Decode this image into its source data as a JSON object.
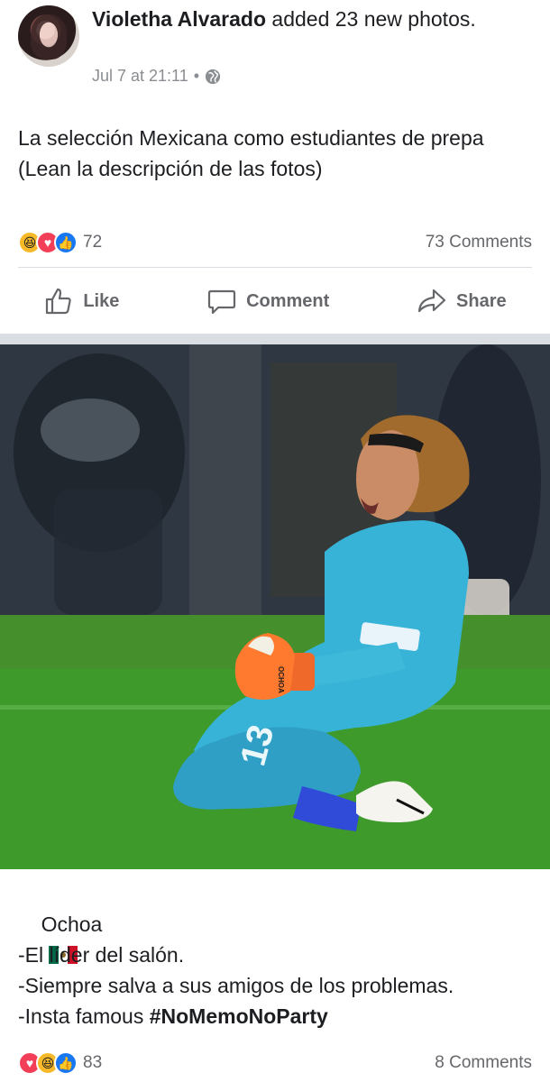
{
  "post": {
    "author": "Violetha Alvarado",
    "action_text": " added 23 new photos.",
    "date": "Jul 7 at 21:11",
    "dot": "•",
    "audience_icon": "globe-icon",
    "text_line1": "La selección Mexicana como estudiantes de prepa",
    "text_line2": "(Lean la descripción de las fotos)",
    "reactions": {
      "icons": [
        "haha",
        "love",
        "like"
      ],
      "count": "72",
      "comments": "73 Comments"
    },
    "actions": {
      "like": "Like",
      "comment": "Comment",
      "share": "Share"
    }
  },
  "photo": {
    "caption_name": "Ochoa",
    "caption_flag": "mexico-flag",
    "caption_lines": [
      "-El líder del salón.",
      "-Siempre salva a sus amigos de los problemas."
    ],
    "caption_line3_prefix": "-Insta famous ",
    "caption_hashtag": "#NoMemoNoParty",
    "reactions": {
      "icons": [
        "love",
        "haha",
        "like"
      ],
      "count": "83",
      "comments": "8 Comments"
    },
    "jersey_number": "13",
    "glove_text": "OCHOA"
  },
  "colors": {
    "accent": "#1877f2",
    "love": "#f33e58",
    "haha": "#f7b928",
    "muted": "#65676b"
  }
}
